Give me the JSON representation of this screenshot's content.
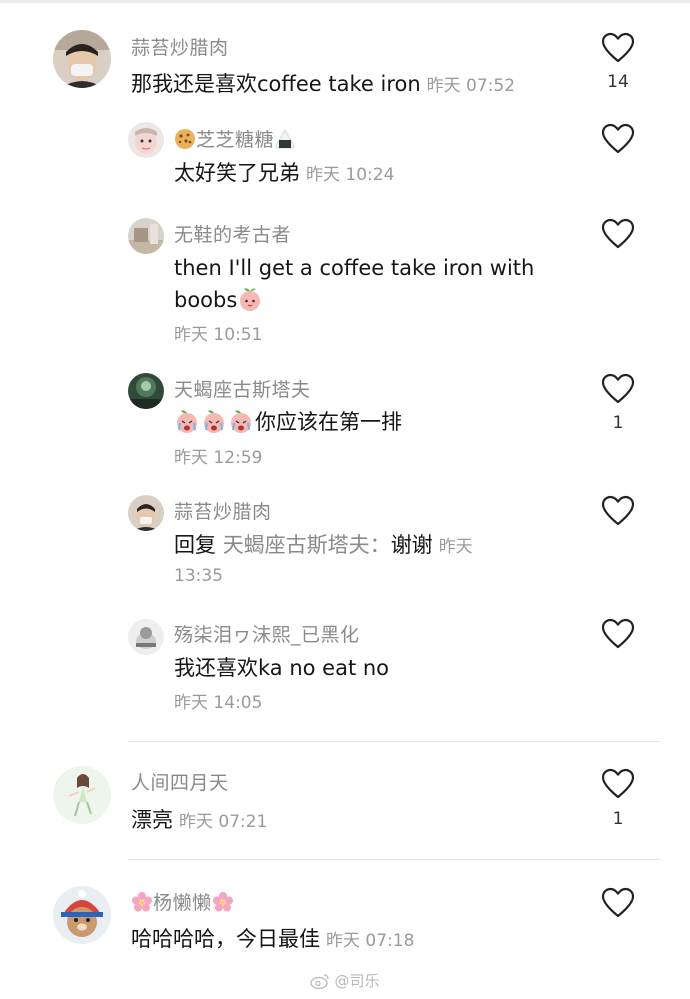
{
  "comments": [
    {
      "username": "蒜苔炒腊肉",
      "text": "那我还是喜欢coffee take iron",
      "time": "昨天 07:52",
      "likes": "14"
    },
    {
      "username": "芝芝糖糖",
      "text": "太好笑了兄弟",
      "time": "昨天 10:24",
      "likes": ""
    },
    {
      "username": "无鞋的考古者",
      "text_line1": "then I'll get a coffee take iron with",
      "text_line2": "boobs",
      "time": "昨天 10:51",
      "likes": ""
    },
    {
      "username": "天蝎座古斯塔夫",
      "text": "你应该在第一排",
      "time": "昨天 12:59",
      "likes": "1"
    },
    {
      "username": "蒜苔炒腊肉",
      "reply_prefix": "回复",
      "reply_target": "天蝎座古斯塔夫：",
      "text": "谢谢",
      "time_part1": "昨天",
      "time_part2": "13:35",
      "likes": ""
    },
    {
      "username": "殇柒泪ヮ沫熙_已黑化",
      "text": "我还喜欢ka no eat no",
      "time": "昨天 14:05",
      "likes": ""
    },
    {
      "username": "人间四月天",
      "text": "漂亮",
      "time": "昨天 07:21",
      "likes": "1"
    },
    {
      "username": "杨懒懒",
      "text": "哈哈哈哈，今日最佳",
      "time": "昨天 07:18",
      "likes": ""
    }
  ],
  "watermark": {
    "text": "@司乐"
  },
  "colors": {
    "username": "#8a8a8a",
    "text": "#161616",
    "time": "#9a9a9a",
    "heart": "#222222",
    "divider": "#e6e6e6"
  }
}
